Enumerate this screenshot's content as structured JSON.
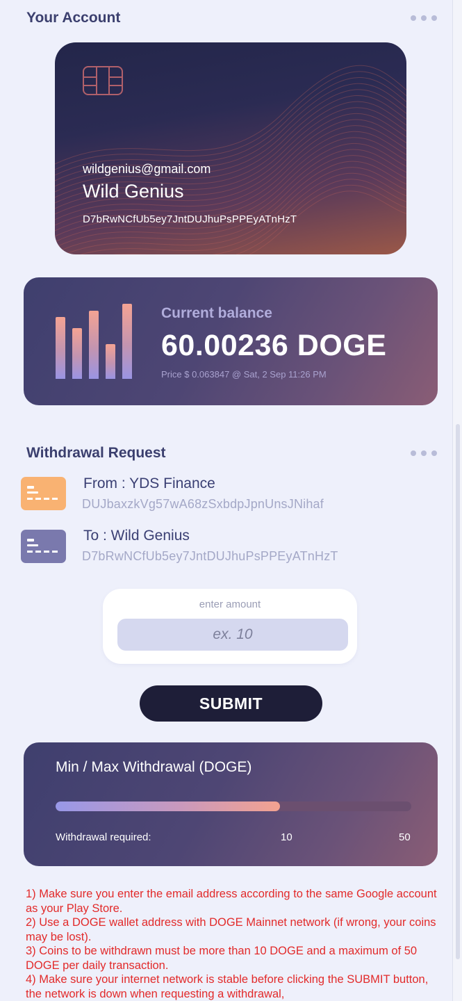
{
  "account": {
    "section_title": "Your Account",
    "card": {
      "email": "wildgenius@gmail.com",
      "name": "Wild Genius",
      "address": "D7bRwNCfUb5ey7JntDUJhuPsPPEyATnHzT"
    }
  },
  "balance": {
    "label": "Current balance",
    "value": "60.00236 DOGE",
    "price": "Price $ 0.063847 @ Sat, 2 Sep 11:26 PM",
    "chart_bars": [
      0.82,
      0.68,
      0.91,
      0.46,
      1.0
    ]
  },
  "withdrawal": {
    "section_title": "Withdrawal Request",
    "from": {
      "title": "From : YDS Finance",
      "address": "DUJbaxzkVg57wA68zSxbdpJpnUnsJNihaf",
      "icon": "wallet-card-icon",
      "icon_color": "#f9b272"
    },
    "to": {
      "title": "To : Wild Genius",
      "address": "D7bRwNCfUb5ey7JntDUJhuPsPPEyATnHzT",
      "icon": "wallet-card-icon",
      "icon_color": "#7a79ad"
    },
    "amount": {
      "label": "enter amount",
      "placeholder": "ex. 10",
      "value": ""
    },
    "submit_label": "SUBMIT"
  },
  "limits": {
    "title": "Min / Max Withdrawal (DOGE)",
    "required_label": "Withdrawal required:",
    "min": "10",
    "max": "50",
    "progress_fraction": 0.63
  },
  "notes": [
    "1) Make sure you enter the email address according to the same Google account as your Play Store.",
    "2) Use a DOGE wallet address with DOGE Mainnet network (if wrong, your coins may be lost).",
    "3) Coins to be withdrawn must be more than 10 DOGE and a maximum of 50 DOGE per daily transaction.",
    "4) Make sure your internet network is stable before clicking the SUBMIT button, the network is down when requesting a withdrawal,"
  ],
  "colors": {
    "background": "#eef0fb",
    "notes_text": "#e22a2a",
    "button": "#1e1e38"
  }
}
